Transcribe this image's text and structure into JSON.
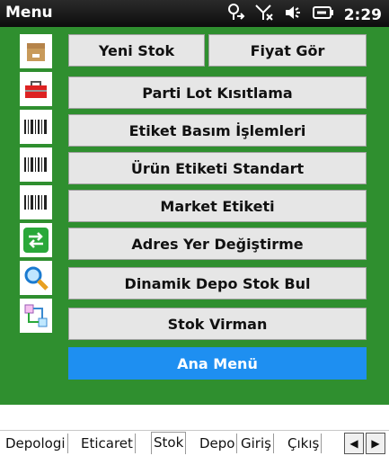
{
  "statusbar": {
    "title": "Menu",
    "time": "2:29",
    "icons": [
      "network-signal-icon",
      "no-signal-icon",
      "volume-icon",
      "battery-icon"
    ]
  },
  "menu": {
    "buttons": [
      {
        "label": "Yeni Stok"
      },
      {
        "label": "Fiyat Gör"
      },
      {
        "label": "Parti Lot Kısıtlama"
      },
      {
        "label": "Etiket Basım İşlemleri"
      },
      {
        "label": "Ürün Etiketi Standart"
      },
      {
        "label": "Market Etiketi"
      },
      {
        "label": "Adres Yer Değiştirme"
      },
      {
        "label": "Dinamik Depo Stok Bul"
      },
      {
        "label": "Stok Virman"
      },
      {
        "label": "Ana Menü"
      }
    ],
    "icons": [
      "box-icon",
      "toolbox-icon",
      "barcode-icon",
      "barcode-icon",
      "barcode-icon",
      "transfer-arrows-icon",
      "magnifier-icon",
      "flow-diagram-icon"
    ]
  },
  "tabs": [
    {
      "label": "Depologi"
    },
    {
      "label": "Eticaret"
    },
    {
      "label": "Stok"
    },
    {
      "label": "Depo"
    },
    {
      "label": "Giriş"
    },
    {
      "label": "Çıkış"
    }
  ],
  "colors": {
    "panel": "#2f8f2f",
    "button": "#e6e6e6",
    "primary_button": "#1e8ff1",
    "statusbar": "#111111"
  }
}
